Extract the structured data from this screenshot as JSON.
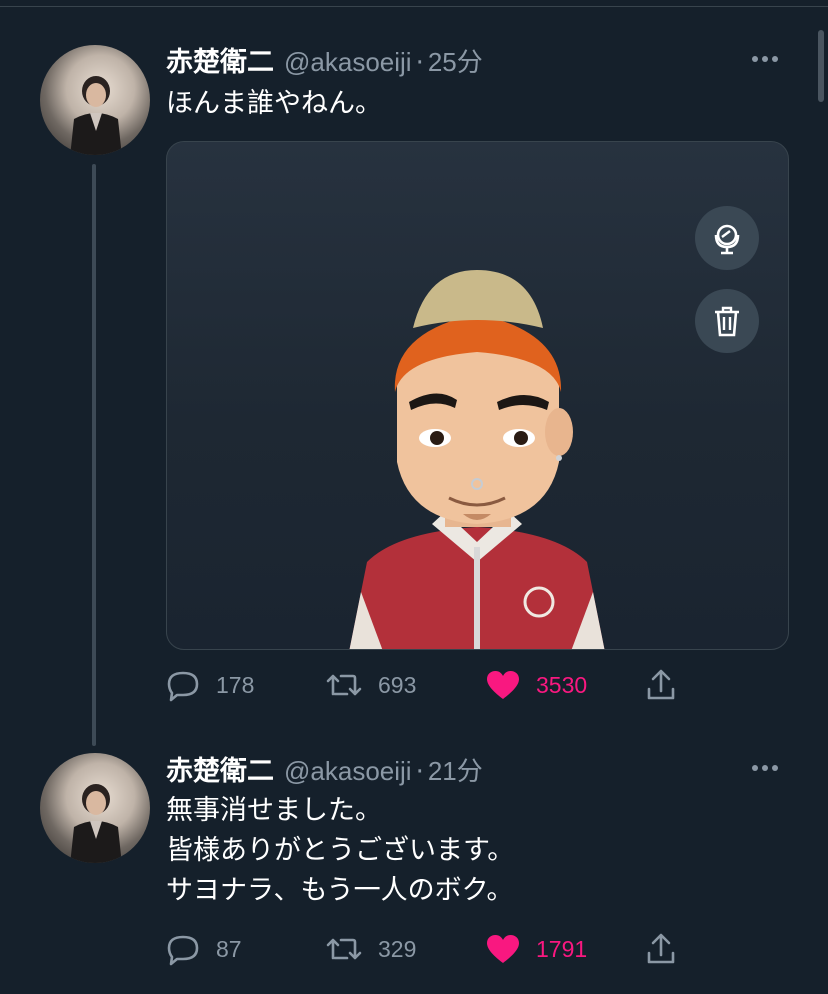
{
  "tweets": [
    {
      "name": "赤楚衛二",
      "handle": "@akasoeiji",
      "dot": "·",
      "time": "25分",
      "text": "ほんま誰やねん。",
      "replies": "178",
      "retweets": "693",
      "likes": "3530",
      "liked": true
    },
    {
      "name": "赤楚衛二",
      "handle": "@akasoeiji",
      "dot": "·",
      "time": "21分",
      "text_lines": [
        "無事消せました。",
        "皆様ありがとうございます。",
        "サヨナラ、もう一人のボク。"
      ],
      "replies": "87",
      "retweets": "329",
      "likes": "1791",
      "liked": true
    }
  ],
  "icons": {
    "reply": "reply-icon",
    "retweet": "retweet-icon",
    "like": "heart-icon",
    "share": "share-icon",
    "mirror": "mirror-icon",
    "trash": "trash-icon",
    "more": "more-icon"
  },
  "colors": {
    "background": "#15202b",
    "secondary_text": "#8b98a5",
    "like": "#f91880",
    "border": "#38444d"
  }
}
